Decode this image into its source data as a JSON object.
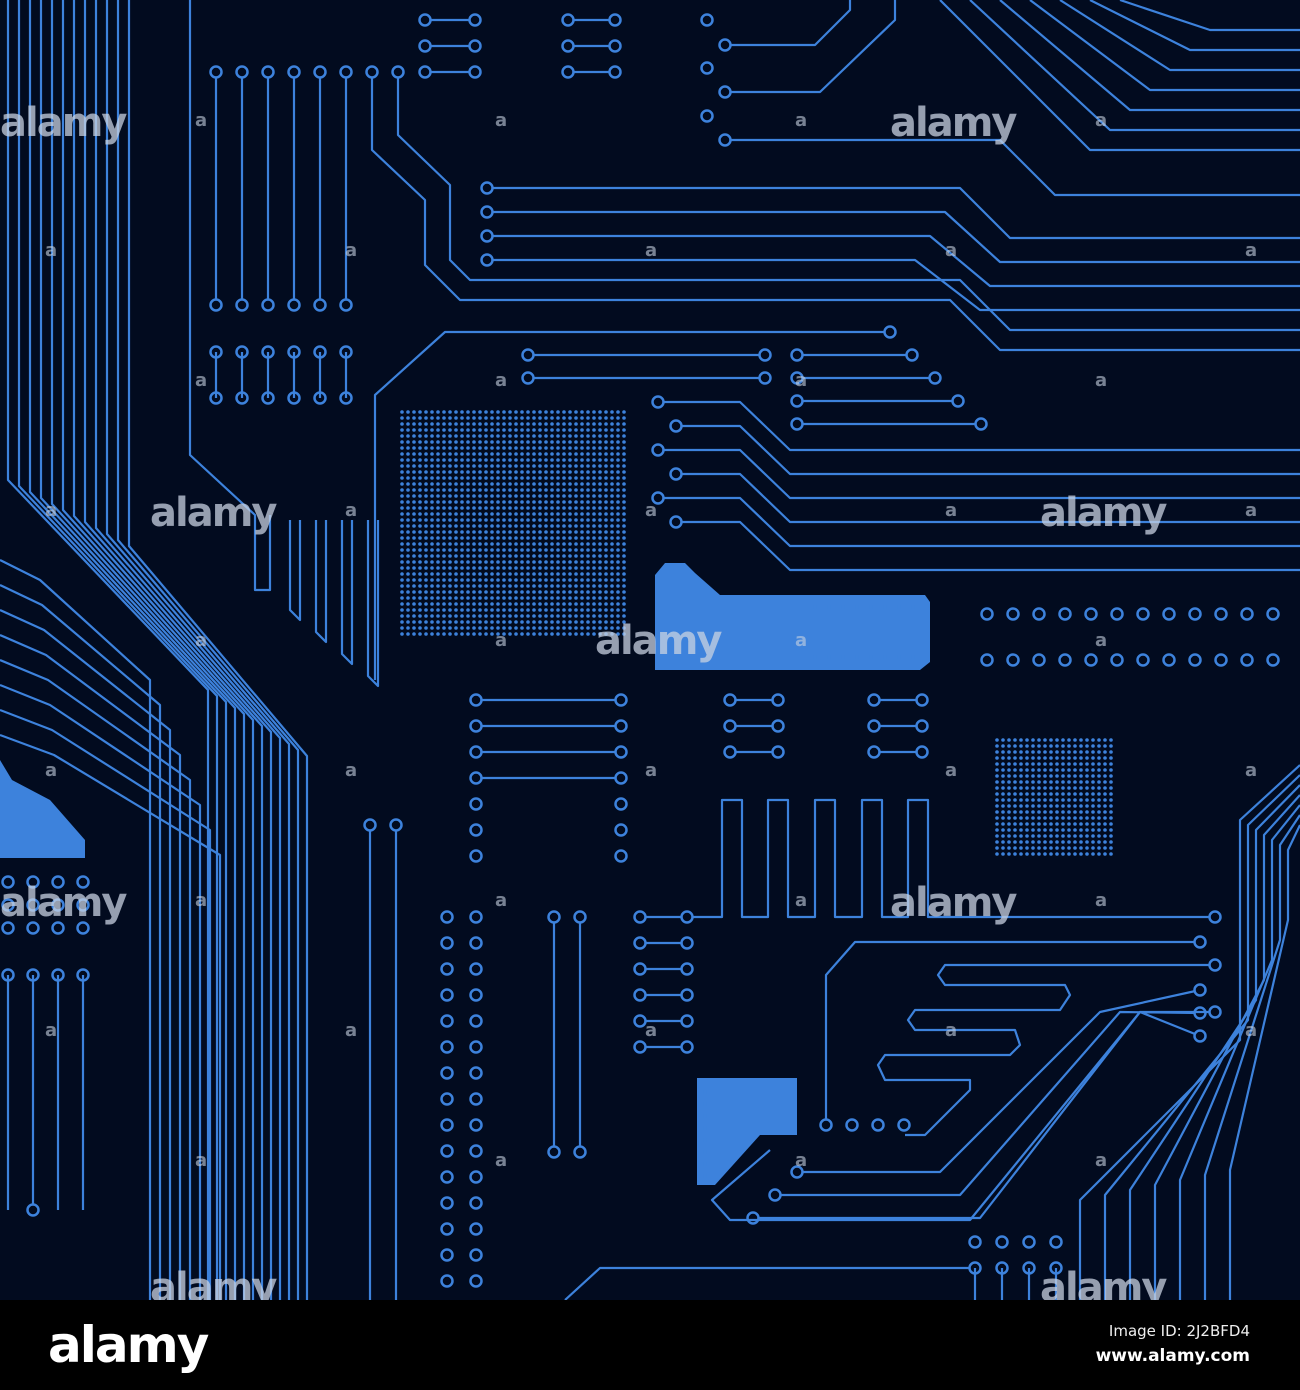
{
  "image": {
    "subject": "blue printed circuit board traces on dark navy background",
    "trace_color": "#3d82dc",
    "background_color": "#020b1f"
  },
  "watermark": {
    "text": "alamy",
    "mark": "a"
  },
  "footer": {
    "logo": "alamy",
    "image_id": "Image ID: 2J2BFD4",
    "website": "www.alamy.com"
  }
}
